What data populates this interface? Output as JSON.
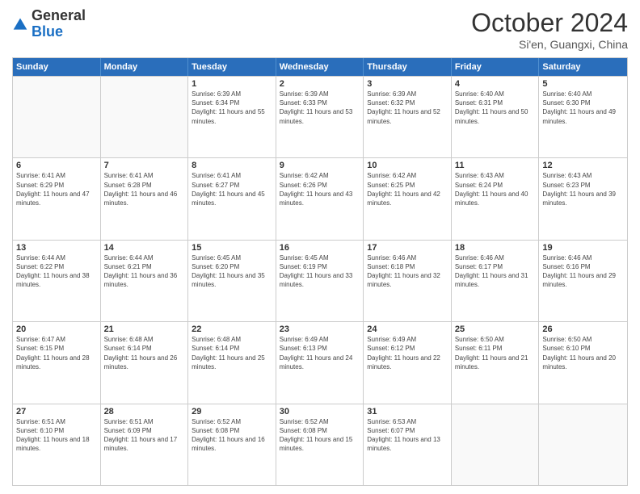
{
  "logo": {
    "text1": "General",
    "text2": "Blue"
  },
  "header": {
    "month": "October 2024",
    "location": "Si'en, Guangxi, China"
  },
  "weekdays": [
    "Sunday",
    "Monday",
    "Tuesday",
    "Wednesday",
    "Thursday",
    "Friday",
    "Saturday"
  ],
  "weeks": [
    [
      {
        "day": "",
        "info": ""
      },
      {
        "day": "",
        "info": ""
      },
      {
        "day": "1",
        "info": "Sunrise: 6:39 AM\nSunset: 6:34 PM\nDaylight: 11 hours and 55 minutes."
      },
      {
        "day": "2",
        "info": "Sunrise: 6:39 AM\nSunset: 6:33 PM\nDaylight: 11 hours and 53 minutes."
      },
      {
        "day": "3",
        "info": "Sunrise: 6:39 AM\nSunset: 6:32 PM\nDaylight: 11 hours and 52 minutes."
      },
      {
        "day": "4",
        "info": "Sunrise: 6:40 AM\nSunset: 6:31 PM\nDaylight: 11 hours and 50 minutes."
      },
      {
        "day": "5",
        "info": "Sunrise: 6:40 AM\nSunset: 6:30 PM\nDaylight: 11 hours and 49 minutes."
      }
    ],
    [
      {
        "day": "6",
        "info": "Sunrise: 6:41 AM\nSunset: 6:29 PM\nDaylight: 11 hours and 47 minutes."
      },
      {
        "day": "7",
        "info": "Sunrise: 6:41 AM\nSunset: 6:28 PM\nDaylight: 11 hours and 46 minutes."
      },
      {
        "day": "8",
        "info": "Sunrise: 6:41 AM\nSunset: 6:27 PM\nDaylight: 11 hours and 45 minutes."
      },
      {
        "day": "9",
        "info": "Sunrise: 6:42 AM\nSunset: 6:26 PM\nDaylight: 11 hours and 43 minutes."
      },
      {
        "day": "10",
        "info": "Sunrise: 6:42 AM\nSunset: 6:25 PM\nDaylight: 11 hours and 42 minutes."
      },
      {
        "day": "11",
        "info": "Sunrise: 6:43 AM\nSunset: 6:24 PM\nDaylight: 11 hours and 40 minutes."
      },
      {
        "day": "12",
        "info": "Sunrise: 6:43 AM\nSunset: 6:23 PM\nDaylight: 11 hours and 39 minutes."
      }
    ],
    [
      {
        "day": "13",
        "info": "Sunrise: 6:44 AM\nSunset: 6:22 PM\nDaylight: 11 hours and 38 minutes."
      },
      {
        "day": "14",
        "info": "Sunrise: 6:44 AM\nSunset: 6:21 PM\nDaylight: 11 hours and 36 minutes."
      },
      {
        "day": "15",
        "info": "Sunrise: 6:45 AM\nSunset: 6:20 PM\nDaylight: 11 hours and 35 minutes."
      },
      {
        "day": "16",
        "info": "Sunrise: 6:45 AM\nSunset: 6:19 PM\nDaylight: 11 hours and 33 minutes."
      },
      {
        "day": "17",
        "info": "Sunrise: 6:46 AM\nSunset: 6:18 PM\nDaylight: 11 hours and 32 minutes."
      },
      {
        "day": "18",
        "info": "Sunrise: 6:46 AM\nSunset: 6:17 PM\nDaylight: 11 hours and 31 minutes."
      },
      {
        "day": "19",
        "info": "Sunrise: 6:46 AM\nSunset: 6:16 PM\nDaylight: 11 hours and 29 minutes."
      }
    ],
    [
      {
        "day": "20",
        "info": "Sunrise: 6:47 AM\nSunset: 6:15 PM\nDaylight: 11 hours and 28 minutes."
      },
      {
        "day": "21",
        "info": "Sunrise: 6:48 AM\nSunset: 6:14 PM\nDaylight: 11 hours and 26 minutes."
      },
      {
        "day": "22",
        "info": "Sunrise: 6:48 AM\nSunset: 6:14 PM\nDaylight: 11 hours and 25 minutes."
      },
      {
        "day": "23",
        "info": "Sunrise: 6:49 AM\nSunset: 6:13 PM\nDaylight: 11 hours and 24 minutes."
      },
      {
        "day": "24",
        "info": "Sunrise: 6:49 AM\nSunset: 6:12 PM\nDaylight: 11 hours and 22 minutes."
      },
      {
        "day": "25",
        "info": "Sunrise: 6:50 AM\nSunset: 6:11 PM\nDaylight: 11 hours and 21 minutes."
      },
      {
        "day": "26",
        "info": "Sunrise: 6:50 AM\nSunset: 6:10 PM\nDaylight: 11 hours and 20 minutes."
      }
    ],
    [
      {
        "day": "27",
        "info": "Sunrise: 6:51 AM\nSunset: 6:10 PM\nDaylight: 11 hours and 18 minutes."
      },
      {
        "day": "28",
        "info": "Sunrise: 6:51 AM\nSunset: 6:09 PM\nDaylight: 11 hours and 17 minutes."
      },
      {
        "day": "29",
        "info": "Sunrise: 6:52 AM\nSunset: 6:08 PM\nDaylight: 11 hours and 16 minutes."
      },
      {
        "day": "30",
        "info": "Sunrise: 6:52 AM\nSunset: 6:08 PM\nDaylight: 11 hours and 15 minutes."
      },
      {
        "day": "31",
        "info": "Sunrise: 6:53 AM\nSunset: 6:07 PM\nDaylight: 11 hours and 13 minutes."
      },
      {
        "day": "",
        "info": ""
      },
      {
        "day": "",
        "info": ""
      }
    ]
  ]
}
